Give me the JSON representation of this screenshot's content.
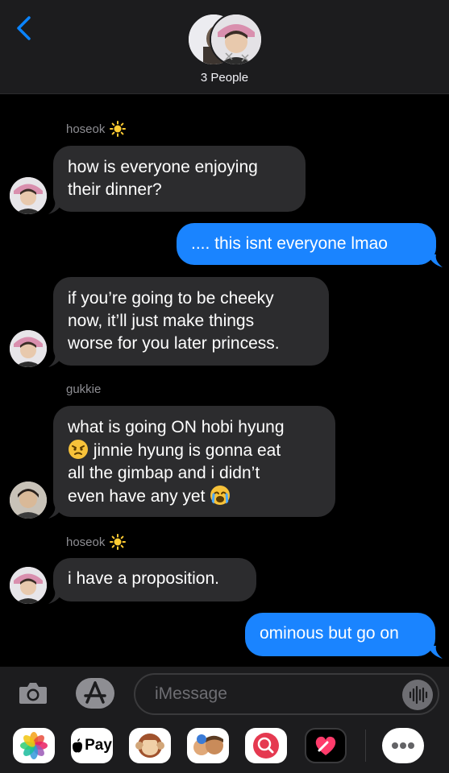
{
  "header": {
    "people_label": "3 People"
  },
  "messages": [
    {
      "sender": "hoseok",
      "sender_emoji": "sun-emoji"
    },
    {
      "text": "how is everyone enjoying\ntheir dinner?"
    },
    {
      "text": ".... this isnt everyone lmao"
    },
    {
      "text": "if you’re going to be cheeky\nnow, it’ll just make things\nworse for you later princess."
    },
    {
      "sender": "gukkie"
    },
    {
      "line1": "what is going ON hobi hyung",
      "line2": "jinnie hyung is gonna eat",
      "line3": "all the gimbap and i didn’t",
      "line4": "even have any yet"
    },
    {
      "sender": "hoseok"
    },
    {
      "text": "i have a proposition."
    },
    {
      "text": "ominous but go on"
    }
  ],
  "input": {
    "placeholder": "iMessage"
  },
  "apps": {
    "applepay_label": "Pay"
  },
  "colors": {
    "incoming_bubble": "#2c2c2e",
    "outgoing_bubble": "#1a84ff",
    "accent": "#0a84ff"
  }
}
